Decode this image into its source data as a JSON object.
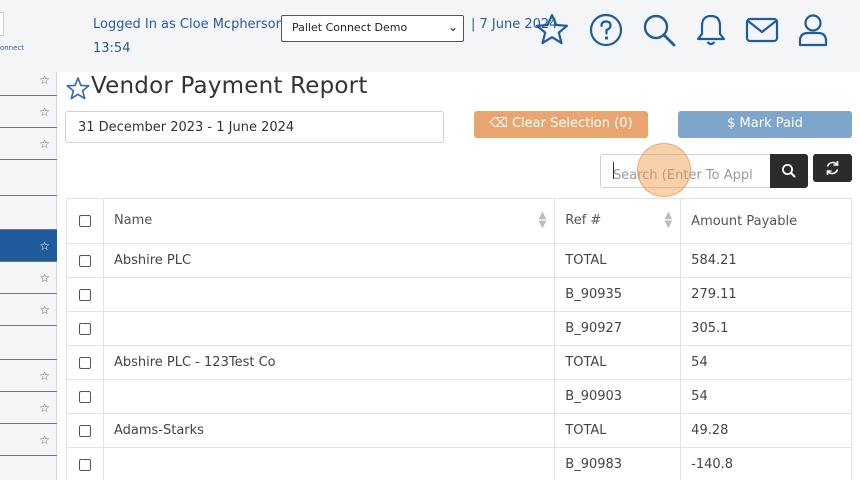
{
  "header": {
    "logo_text": "onnect",
    "logged_in": "Logged In as Cloe Mcpherson |",
    "company": "Pallet Connect Demo",
    "date": "| 7 June 2024",
    "time": "13:54",
    "icons": [
      "star-icon",
      "help-icon",
      "search-icon",
      "bell-icon",
      "mail-icon",
      "user-icon"
    ]
  },
  "sidebar": {
    "active_index": 5,
    "items": [
      {
        "starred": true
      },
      {
        "starred": true
      },
      {
        "starred": true
      },
      {
        "starred": false
      },
      {
        "starred": false
      },
      {
        "starred": true
      },
      {
        "starred": true
      },
      {
        "starred": true
      },
      {
        "starred": false
      },
      {
        "starred": true
      },
      {
        "starred": true
      },
      {
        "starred": true
      }
    ]
  },
  "page": {
    "title": "Vendor Payment Report"
  },
  "filters": {
    "date_range": "31 December 2023 - 1 June 2024",
    "clear_selection": "⌫ Clear Selection (0)",
    "mark_paid": "$ Mark Paid",
    "search_placeholder": "Search (Enter To Appl"
  },
  "table": {
    "columns": [
      "Name",
      "Ref #",
      "Amount Payable"
    ],
    "rows": [
      {
        "name": "Abshire PLC",
        "ref": "TOTAL",
        "amount": "584.21"
      },
      {
        "name": "",
        "ref": "B_90935",
        "amount": "279.11"
      },
      {
        "name": "",
        "ref": "B_90927",
        "amount": "305.1"
      },
      {
        "name": "Abshire PLC - 123Test Co",
        "ref": "TOTAL",
        "amount": "54"
      },
      {
        "name": "",
        "ref": "B_90903",
        "amount": "54"
      },
      {
        "name": "Adams-Starks",
        "ref": "TOTAL",
        "amount": "49.28"
      },
      {
        "name": "",
        "ref": "B_90983",
        "amount": "-140.8"
      }
    ]
  },
  "colors": {
    "link_blue": "#2c5a9c",
    "sidebar_active": "#205b9c",
    "clear_button": "#e9a470",
    "mark_paid_button": "#7ea6ca",
    "dark_button": "#2b2b2b"
  }
}
